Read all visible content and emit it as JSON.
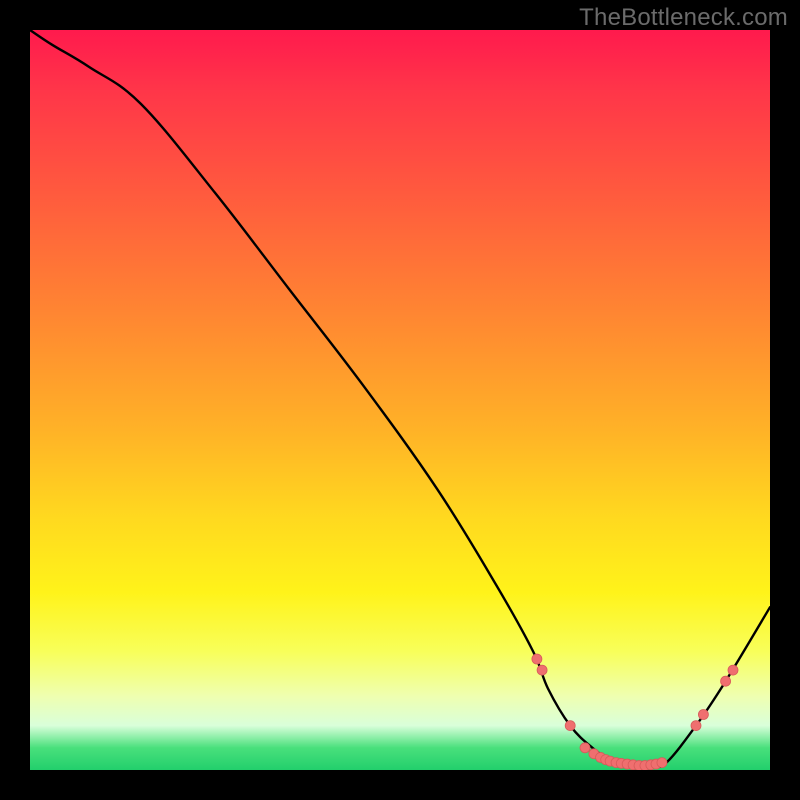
{
  "watermark": "TheBottleneck.com",
  "colors": {
    "line": "#000000",
    "marker_fill": "#ef6f6f",
    "marker_stroke": "#d85a5a",
    "bg_black": "#000000"
  },
  "chart_data": {
    "type": "line",
    "title": "",
    "xlabel": "",
    "ylabel": "",
    "xlim": [
      0,
      100
    ],
    "ylim": [
      0,
      100
    ],
    "grid": false,
    "series": [
      {
        "name": "bottleneck-curve",
        "x": [
          0,
          3,
          8,
          15,
          25,
          35,
          45,
          55,
          63,
          68,
          70,
          73,
          76,
          79,
          82,
          84,
          86,
          90,
          94,
          100
        ],
        "y": [
          100,
          98,
          95,
          90,
          78,
          65,
          52,
          38,
          25,
          16,
          11,
          6,
          3,
          1,
          0.5,
          0.5,
          1,
          6,
          12,
          22
        ]
      }
    ],
    "markers": {
      "name": "highlight-dots",
      "x": [
        68.5,
        69.2,
        73.0,
        75.0,
        76.2,
        77.1,
        77.8,
        78.4,
        79.2,
        79.9,
        80.7,
        81.5,
        82.3,
        83.1,
        83.9,
        84.6,
        85.4,
        90.0,
        91.0,
        94.0,
        95.0
      ],
      "y": [
        15.0,
        13.5,
        6.0,
        3.0,
        2.2,
        1.7,
        1.4,
        1.2,
        1.0,
        0.9,
        0.8,
        0.7,
        0.6,
        0.6,
        0.7,
        0.8,
        1.0,
        6.0,
        7.5,
        12.0,
        13.5
      ]
    }
  }
}
